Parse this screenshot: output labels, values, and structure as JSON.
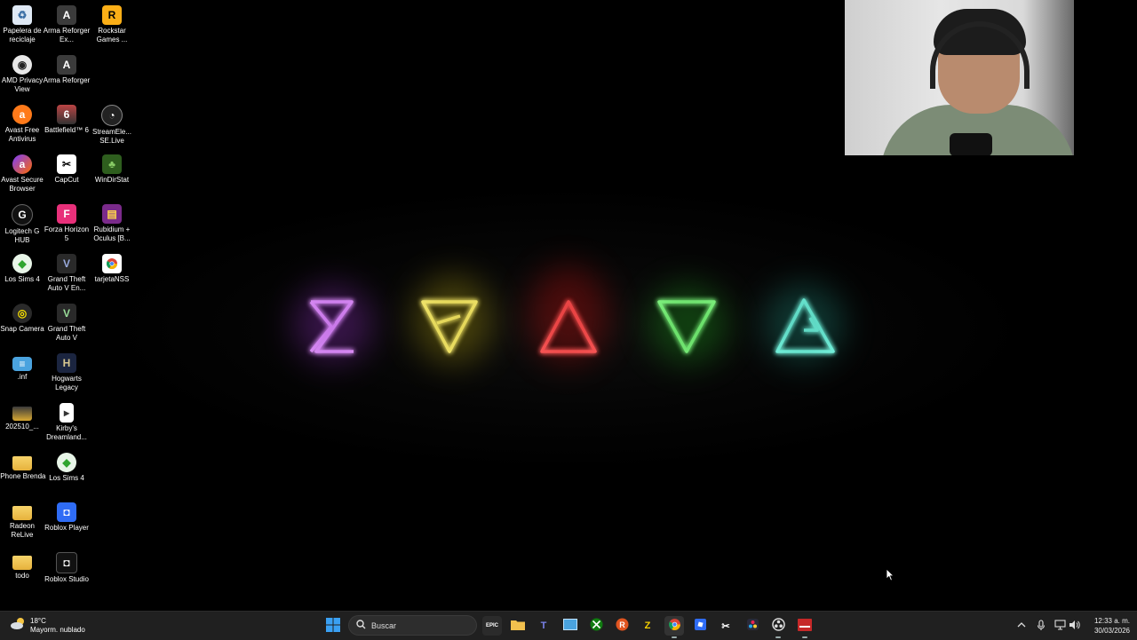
{
  "desktop": {
    "icons": [
      {
        "label": "Papelera de reciclaje",
        "icon": "recycle-bin-icon"
      },
      {
        "label": "Arma Reforger Ex...",
        "icon": "arma-icon"
      },
      {
        "label": "Rockstar Games ...",
        "icon": "rockstar-icon"
      },
      {
        "label": "AMD Privacy View",
        "icon": "eye-icon"
      },
      {
        "label": "Arma Reforger",
        "icon": "arma-icon"
      },
      {
        "label": "Avast Free Antivirus",
        "icon": "avast-icon"
      },
      {
        "label": "Battlefield™ 6",
        "icon": "battlefield-icon"
      },
      {
        "label": "StreamEle... SE.Live",
        "icon": "streamelements-icon"
      },
      {
        "label": "Avast Secure Browser",
        "icon": "avast-browser-icon"
      },
      {
        "label": "CapCut",
        "icon": "capcut-icon"
      },
      {
        "label": "WinDirStat",
        "icon": "tree-icon"
      },
      {
        "label": "Logitech G HUB",
        "icon": "logitech-icon"
      },
      {
        "label": "Forza Horizon 5",
        "icon": "forza-icon"
      },
      {
        "label": "Rubidium + Oculus [B...",
        "icon": "archive-icon"
      },
      {
        "label": "Los Sims 4",
        "icon": "plumbob-icon"
      },
      {
        "label": "Grand Theft Auto V En...",
        "icon": "gta-icon"
      },
      {
        "label": "tarjetaNSS",
        "icon": "chrome-icon"
      },
      {
        "label": "Snap Camera",
        "icon": "camera-icon"
      },
      {
        "label": "Grand Theft Auto V",
        "icon": "gta-icon"
      },
      {
        "label": ".inf",
        "icon": "file-icon"
      },
      {
        "label": "Hogwarts Legacy",
        "icon": "hogwarts-icon"
      },
      {
        "label": "202510_...",
        "icon": "folder-icon"
      },
      {
        "label": "Kirby's Dreamland...",
        "icon": "document-icon"
      },
      {
        "label": "iPhone Brenda",
        "icon": "folder-icon"
      },
      {
        "label": "Los Sims 4",
        "icon": "plumbob-icon"
      },
      {
        "label": "Radeon ReLive",
        "icon": "folder-icon"
      },
      {
        "label": "Roblox Player",
        "icon": "roblox-icon"
      },
      {
        "label": "todo",
        "icon": "folder-icon"
      },
      {
        "label": "Roblox Studio",
        "icon": "roblox-studio-icon"
      }
    ],
    "wallpaper_colors": [
      "#c040ff",
      "#f0e020",
      "#ff2020",
      "#30e030",
      "#30e0c0"
    ]
  },
  "taskbar": {
    "weather": {
      "temp": "18°C",
      "condition": "Mayorm. nublado"
    },
    "search_label": "Buscar",
    "apps": [
      {
        "name": "windows-start",
        "icon": "windows-icon"
      },
      {
        "name": "epic-games",
        "icon": "epic-games-icon",
        "text": "EPIC"
      },
      {
        "name": "file-explorer",
        "icon": "folder-icon"
      },
      {
        "name": "teams",
        "icon": "teams-icon"
      },
      {
        "name": "control-panel",
        "icon": "window-icon"
      },
      {
        "name": "xbox",
        "icon": "xbox-icon"
      },
      {
        "name": "rockstar",
        "icon": "rockstar-icon"
      },
      {
        "name": "z-app",
        "icon": "z-icon"
      },
      {
        "name": "chrome",
        "icon": "chrome-icon"
      },
      {
        "name": "roblox",
        "icon": "roblox-icon"
      },
      {
        "name": "capcut",
        "icon": "capcut-icon"
      },
      {
        "name": "davinci",
        "icon": "davinci-icon"
      },
      {
        "name": "obs",
        "icon": "obs-icon"
      },
      {
        "name": "recording-app",
        "icon": "record-icon"
      }
    ],
    "clock": {
      "time": "12:33 a. m.",
      "date": "30/03/2026"
    }
  }
}
